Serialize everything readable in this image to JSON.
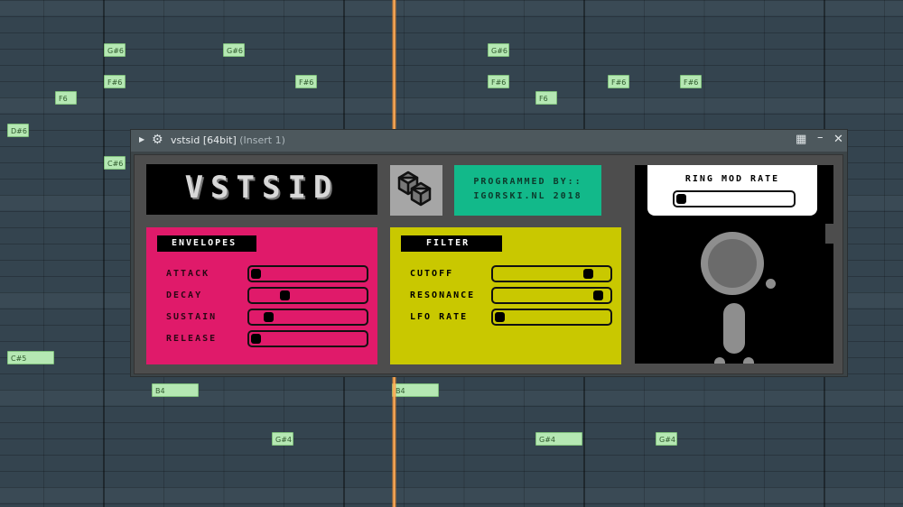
{
  "piano_roll": {
    "notes": [
      {
        "label": "G#6",
        "size": "narrow"
      },
      {
        "label": "G#6",
        "size": "narrow"
      },
      {
        "label": "G#6",
        "size": "narrow"
      },
      {
        "label": "F#6",
        "size": "narrow"
      },
      {
        "label": "F#6",
        "size": "narrow"
      },
      {
        "label": "F#6",
        "size": "narrow"
      },
      {
        "label": "F#6",
        "size": "narrow"
      },
      {
        "label": "F#6",
        "size": "narrow"
      },
      {
        "label": "F6",
        "size": "narrow"
      },
      {
        "label": "F6",
        "size": "narrow"
      },
      {
        "label": "D#6",
        "size": "narrow"
      },
      {
        "label": "C#6",
        "size": "narrow"
      },
      {
        "label": "C#5",
        "size": "wide"
      },
      {
        "label": "B4",
        "size": "wide"
      },
      {
        "label": "B4",
        "size": "wide"
      },
      {
        "label": "G#4",
        "size": "narrow"
      },
      {
        "label": "G#4",
        "size": "wide"
      },
      {
        "label": "G#4",
        "size": "narrow"
      }
    ]
  },
  "window": {
    "title": "vstsid [64bit]",
    "subtitle": "(Insert 1)",
    "icons": {
      "expand": "chevron-right-icon",
      "settings": "gear-icon",
      "menu": "grid-menu-icon",
      "minimize": "minimize-icon",
      "close": "close-icon"
    }
  },
  "plugin": {
    "logo": "VSTSID",
    "credits_line1": "PROGRAMMED BY::",
    "credits_line2": "IGORSKI.NL 2018",
    "envelopes": {
      "header": "ENVELOPES",
      "params": [
        {
          "label": "ATTACK",
          "value": 0.0
        },
        {
          "label": "DECAY",
          "value": 0.28
        },
        {
          "label": "SUSTAIN",
          "value": 0.12
        },
        {
          "label": "RELEASE",
          "value": 0.0
        }
      ]
    },
    "filter": {
      "header": "FILTER",
      "params": [
        {
          "label": "CUTOFF",
          "value": 0.85
        },
        {
          "label": "RESONANCE",
          "value": 0.95
        },
        {
          "label": "LFO RATE",
          "value": 0.0
        }
      ]
    },
    "ring_mod": {
      "label": "RING MOD RATE",
      "value": 0.0
    }
  },
  "colors": {
    "envelopes": "#e01a6a",
    "filter": "#c9c800",
    "credits": "#12b98a",
    "playhead": "#ff9a3c",
    "note": "#b5e8b3"
  }
}
